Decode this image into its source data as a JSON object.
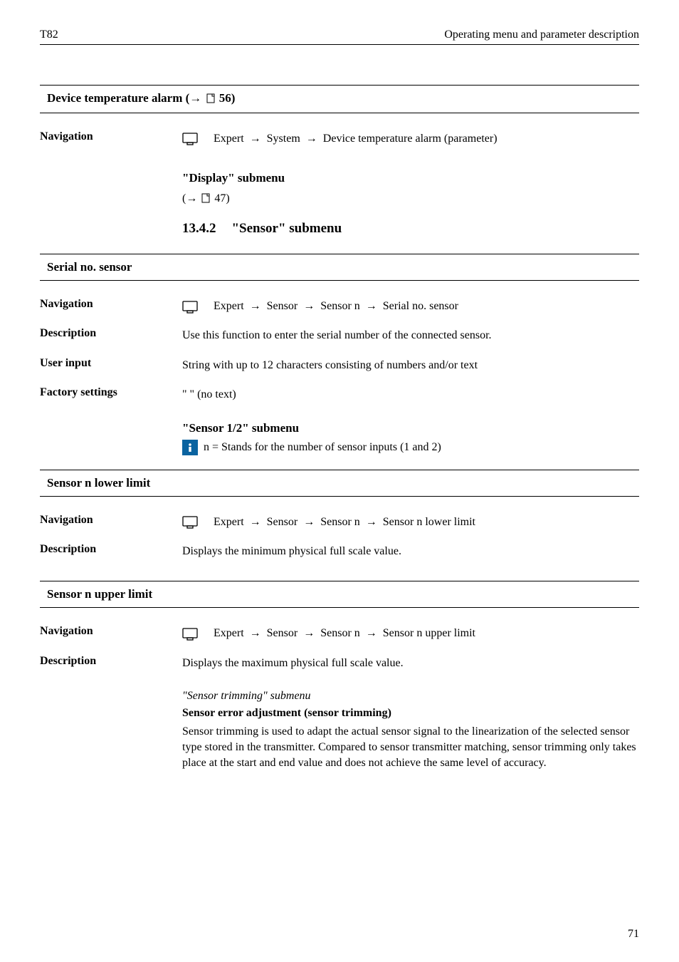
{
  "header": {
    "left": "T82",
    "right": "Operating menu and parameter description"
  },
  "sec1": {
    "title_pre": "Device temperature alarm (→ ",
    "title_page": "56)",
    "nav_label": "Navigation",
    "nav_pre": "Expert ",
    "nav_seg2": " System ",
    "nav_seg3": " Device temperature alarm (parameter)"
  },
  "display_sub": {
    "title": "\"Display\" submenu",
    "ref_pre": "(→ ",
    "ref_page": "47)"
  },
  "sensor_heading": {
    "num": "13.4.2",
    "title": "\"Sensor\" submenu"
  },
  "serial": {
    "title": "Serial no. sensor",
    "nav_label": "Navigation",
    "nav_pre": "Expert ",
    "nav_seg2": " Sensor ",
    "nav_seg3": " Sensor n ",
    "nav_seg4": " Serial no. sensor",
    "desc_label": "Description",
    "desc_val": "Use this function to enter the serial number of the connected sensor.",
    "input_label": "User input",
    "input_val": "String with up to 12 characters consisting of numbers and/or text",
    "factory_label": "Factory settings",
    "factory_val": "\" \" (no text)"
  },
  "sensor12": {
    "title": "\"Sensor 1/2\" submenu",
    "info": "n = Stands for the number of sensor inputs (1 and 2)"
  },
  "lower": {
    "title": "Sensor n lower limit",
    "nav_label": "Navigation",
    "nav_pre": "Expert ",
    "nav_seg2": " Sensor ",
    "nav_seg3": " Sensor n ",
    "nav_seg4": " Sensor n lower limit",
    "desc_label": "Description",
    "desc_val": "Displays the minimum physical full scale value."
  },
  "upper": {
    "title": "Sensor n upper limit",
    "nav_label": "Navigation",
    "nav_pre": "Expert ",
    "nav_seg2": " Sensor ",
    "nav_seg3": " Sensor n ",
    "nav_seg4": " Sensor n upper limit",
    "desc_label": "Description",
    "desc_val": "Displays the maximum physical full scale value."
  },
  "trimming": {
    "ital": "\"Sensor trimming\" submenu",
    "bold": "Sensor error adjustment (sensor trimming)",
    "body": "Sensor trimming is used to adapt the actual sensor signal to the linearization of the selected sensor type stored in the transmitter. Compared to sensor transmitter matching, sensor trimming only takes place at the start and end value and does not achieve the same level of accuracy."
  },
  "pagenum": "71",
  "glyphs": {
    "arrow": "→"
  }
}
